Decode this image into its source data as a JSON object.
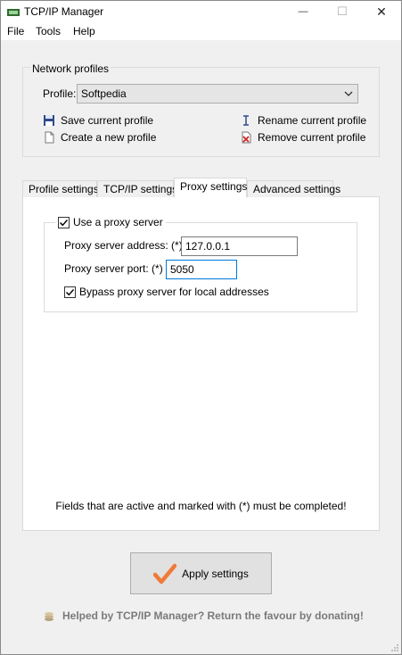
{
  "window": {
    "title": "TCP/IP Manager",
    "minimize_glyph": "—",
    "maximize_glyph": "☐",
    "close_glyph": "✕"
  },
  "menu": [
    "File",
    "Tools",
    "Help"
  ],
  "network_profiles": {
    "group_label": "Network profiles",
    "profile_label": "Profile:",
    "selected_profile": "Softpedia",
    "actions": {
      "save": "Save current profile",
      "create": "Create a new profile",
      "rename": "Rename current profile",
      "remove": "Remove current profile"
    }
  },
  "tabs": [
    {
      "label": "Profile settings",
      "active": false
    },
    {
      "label": "TCP/IP settings",
      "active": false
    },
    {
      "label": "Proxy settings",
      "active": true
    },
    {
      "label": "Advanced settings",
      "active": false
    }
  ],
  "proxy": {
    "use_proxy_label": "Use a proxy server",
    "use_proxy_checked": true,
    "address_label": "Proxy server address: (*)",
    "address_value": "127.0.0.1",
    "port_label": "Proxy server port: (*)",
    "port_value": "5050",
    "bypass_label": "Bypass proxy server for local addresses",
    "bypass_checked": true
  },
  "required_note": "Fields that are active and marked with (*) must be completed!",
  "apply_button": "Apply settings",
  "donate_text": "Helped by TCP/IP Manager? Return the favour by donating!",
  "colors": {
    "window_bg": "#f0f0f0",
    "tab_content_bg": "#ffffff",
    "focus_border": "#0078d7",
    "checkmark_orange": "#f07a3a",
    "donate_text": "#7a7a7a"
  }
}
